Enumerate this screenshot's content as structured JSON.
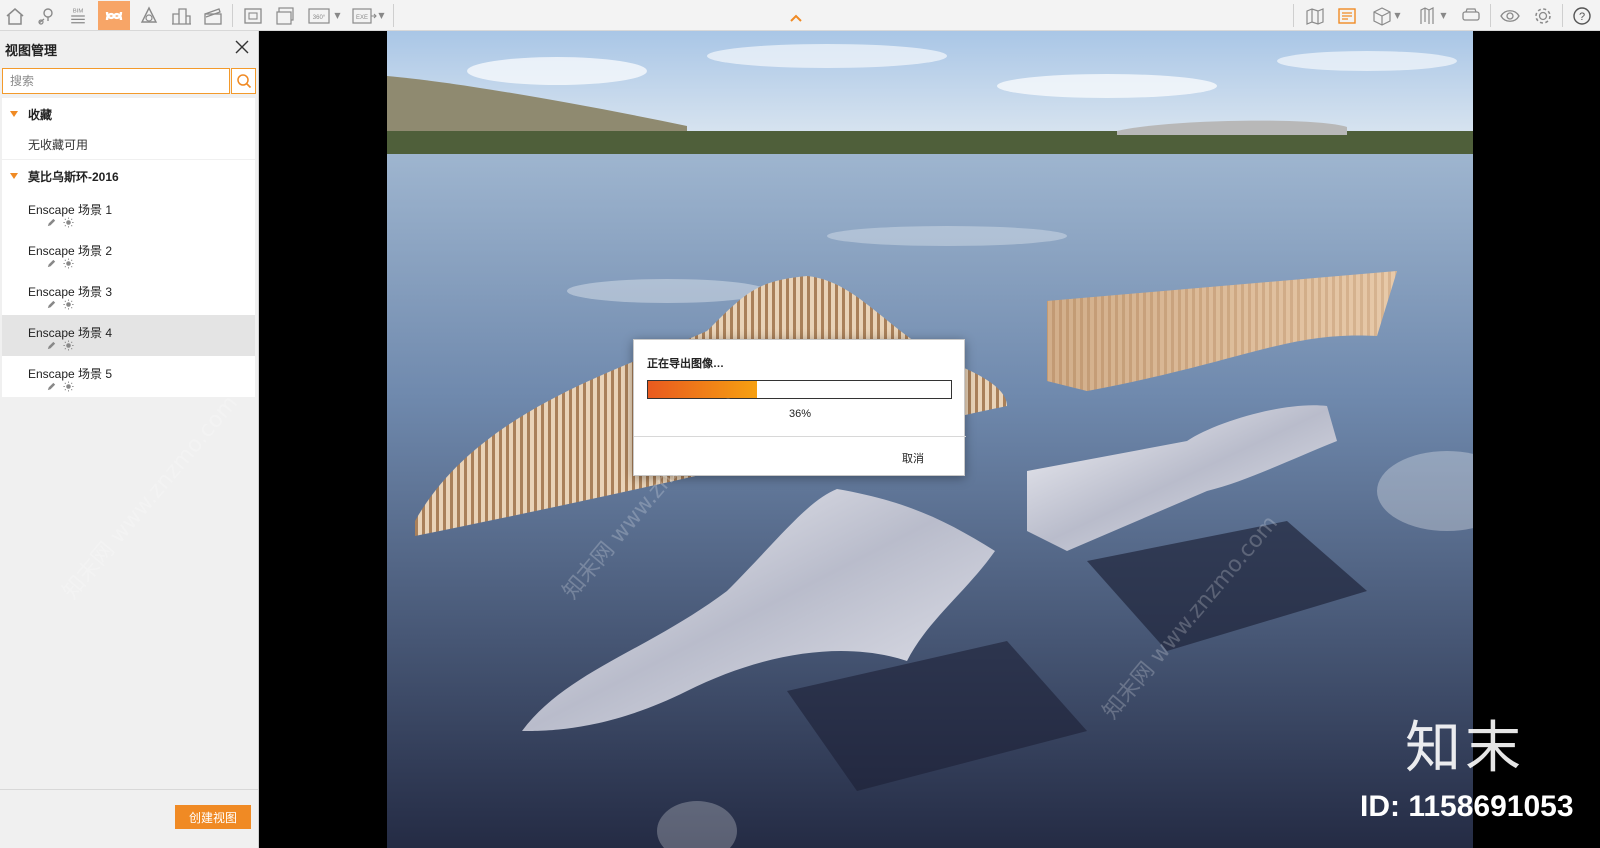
{
  "toolbar": {
    "left_icons": [
      "home-icon",
      "location-pin-icon",
      "bim-icon",
      "enscape-logo-icon",
      "asset-library-icon",
      "buildings-icon",
      "clapper-icon",
      "screenshot-icon",
      "batch-render-icon",
      "panorama-360-icon",
      "export-exe-icon"
    ],
    "bim_label": "BIM",
    "pano_label": "360°",
    "exe_label": "EXE",
    "right_icons": [
      "map-icon",
      "views-panel-icon",
      "cube-icon",
      "bookmark-icon",
      "vr-headset-icon",
      "eye-icon",
      "gear-icon",
      "help-icon"
    ],
    "help_label": "?",
    "accent": "#f08a24"
  },
  "sidebar": {
    "title": "视图管理",
    "search_placeholder": "搜索",
    "favorites": {
      "label": "收藏",
      "empty_text": "无收藏可用"
    },
    "project": {
      "label": "莫比乌斯环-2016",
      "scenes": [
        {
          "label": "Enscape 场景 1",
          "selected": false
        },
        {
          "label": "Enscape 场景 2",
          "selected": false
        },
        {
          "label": "Enscape 场景 3",
          "selected": false
        },
        {
          "label": "Enscape 场景 4",
          "selected": true
        },
        {
          "label": "Enscape 场景 5",
          "selected": false
        }
      ]
    },
    "create_view_label": "创建视图"
  },
  "export_dialog": {
    "title": "正在导出图像…",
    "progress_percent": 36,
    "progress_text": "36%",
    "cancel_label": "取消"
  },
  "watermark": {
    "logo_text": "知末",
    "id_text": "ID: 1158691053",
    "repeat_text": "知末网 www.znzmo.com"
  }
}
